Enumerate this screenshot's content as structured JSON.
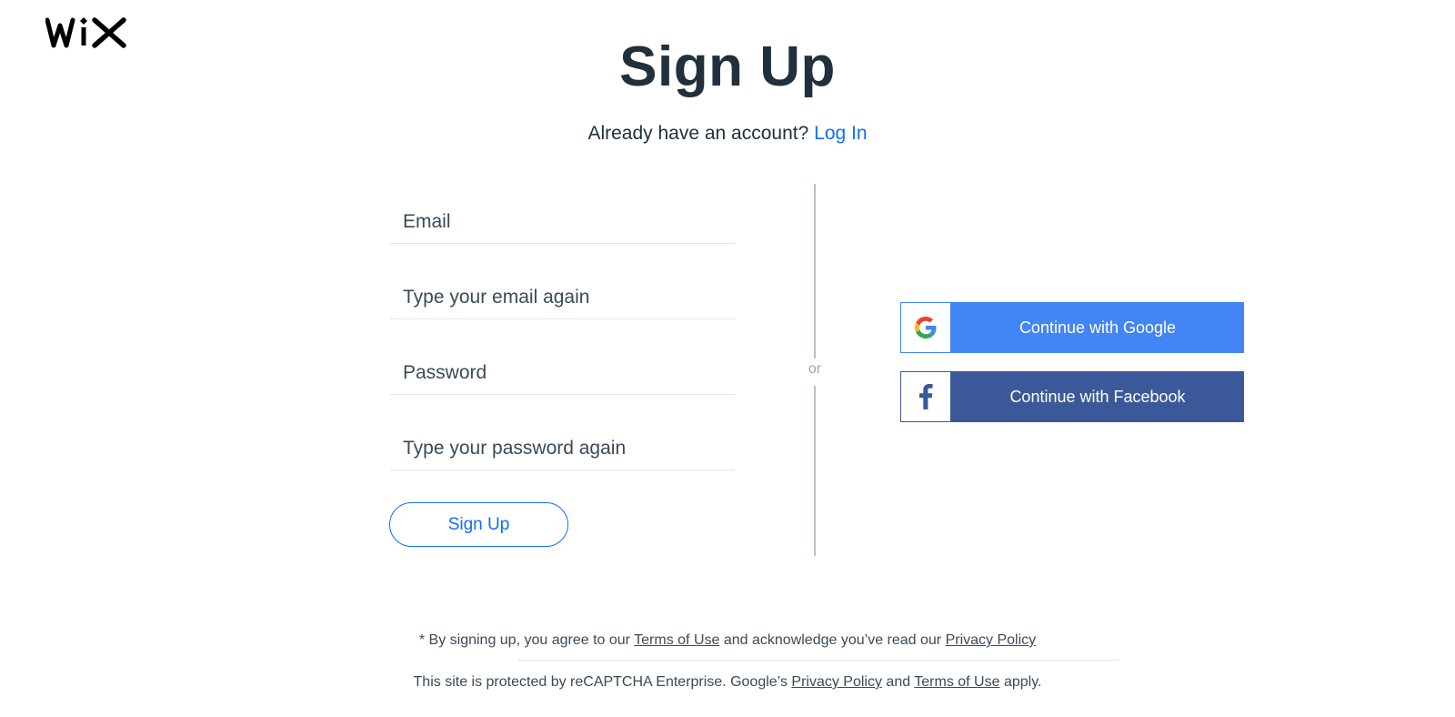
{
  "brand": {
    "logo_text": "WiX"
  },
  "header": {
    "title": "Sign Up",
    "subtitle_prefix": "Already have an account?",
    "login_link": "Log In"
  },
  "form": {
    "email_placeholder": "Email",
    "email_confirm_placeholder": "Type your email again",
    "password_placeholder": "Password",
    "password_confirm_placeholder": "Type your password again",
    "submit_label": "Sign Up"
  },
  "divider": {
    "text": "or"
  },
  "social": {
    "google_label": "Continue with Google",
    "facebook_label": "Continue with Facebook",
    "google_color": "#4285F4",
    "facebook_color": "#3B5998"
  },
  "footer": {
    "terms_prefix": "* By signing up, you agree to our ",
    "terms_link": "Terms of Use",
    "terms_middle": " and acknowledge you’ve read our ",
    "privacy_link": "Privacy Policy",
    "recaptcha_prefix": "This site is protected by reCAPTCHA Enterprise. Google’s ",
    "recaptcha_privacy_link": "Privacy Policy",
    "recaptcha_and": " and ",
    "recaptcha_terms_link": "Terms of Use",
    "recaptcha_suffix": " apply."
  },
  "colors": {
    "accent": "#116DFF",
    "text": "#20303C"
  }
}
